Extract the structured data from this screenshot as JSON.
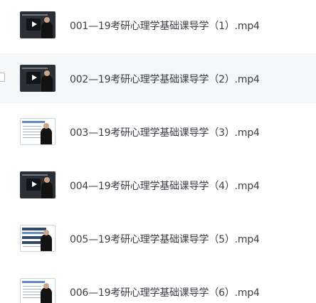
{
  "files": [
    {
      "name": "001—19考研心理学基础课导学（1）.mp4",
      "thumbnail": "video-thumbnail-dark"
    },
    {
      "name": "002—19考研心理学基础课导学（2）.mp4",
      "thumbnail": "video-thumbnail-dark"
    },
    {
      "name": "003—19考研心理学基础课导学（3）.mp4",
      "thumbnail": "video-thumbnail-slide"
    },
    {
      "name": "004—19考研心理学基础课导学（4）.mp4",
      "thumbnail": "video-thumbnail-dark"
    },
    {
      "name": "005—19考研心理学基础课导学（5）.mp4",
      "thumbnail": "video-thumbnail-slide"
    },
    {
      "name": "006—19考研心理学基础课导学（6）.mp4",
      "thumbnail": "video-thumbnail-slide"
    }
  ],
  "colors": {
    "hover_row_background": "#f5f6f7",
    "file_name_text": "#3b3f45"
  }
}
